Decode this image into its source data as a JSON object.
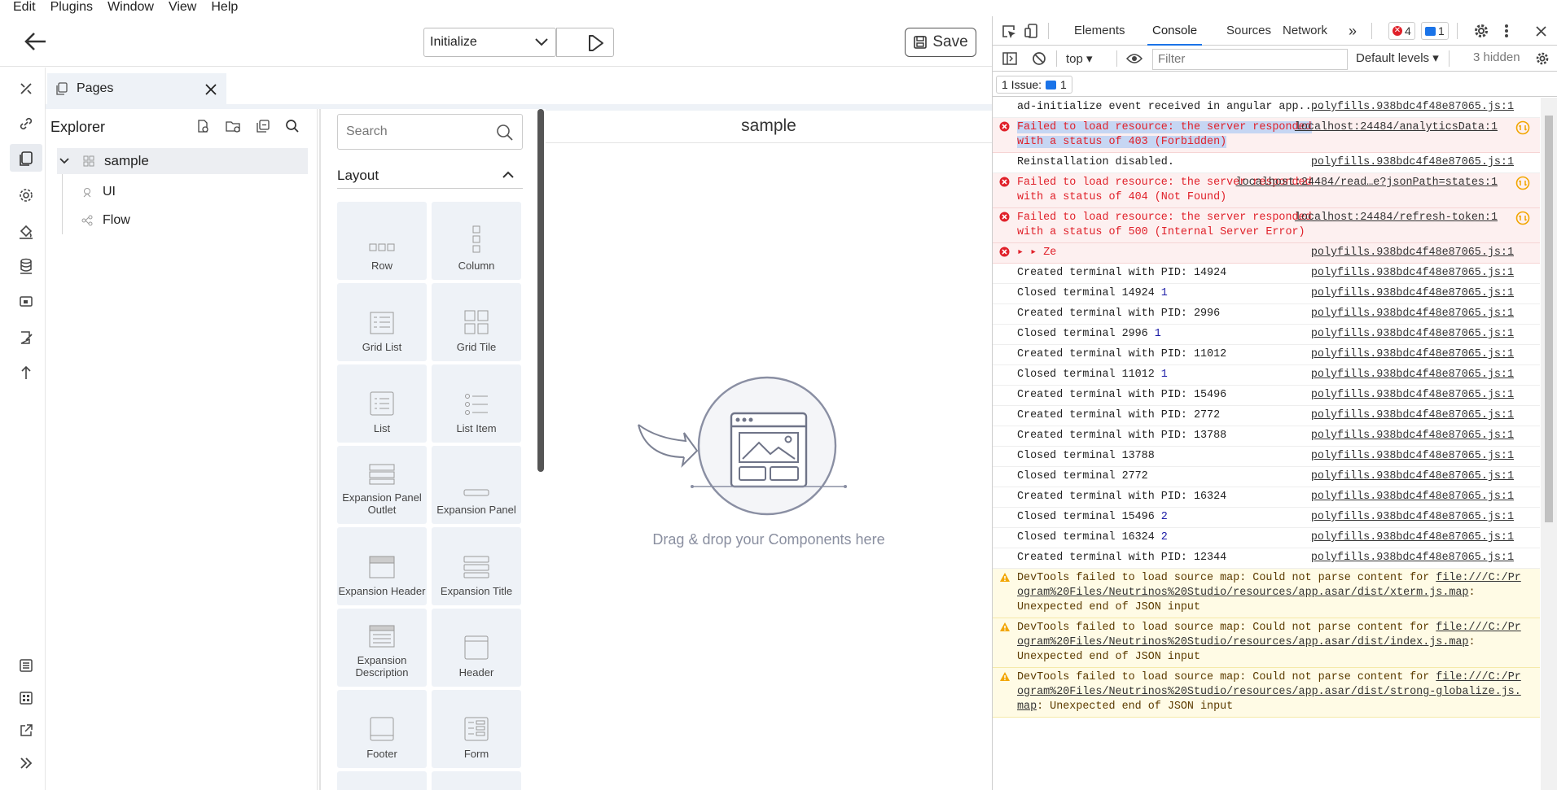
{
  "menu": [
    "Edit",
    "Plugins",
    "Window",
    "View",
    "Help"
  ],
  "toolbar": {
    "select_value": "Initialize",
    "save_label": "Save"
  },
  "pages_tab": {
    "label": "Pages"
  },
  "explorer": {
    "title": "Explorer",
    "tree": [
      {
        "label": "sample"
      },
      {
        "label": "UI"
      },
      {
        "label": "Flow"
      }
    ]
  },
  "palette": {
    "search_placeholder": "Search",
    "section": "Layout",
    "tiles": [
      {
        "label": "Row"
      },
      {
        "label": "Column"
      },
      {
        "label": "Grid List"
      },
      {
        "label": "Grid Tile"
      },
      {
        "label": "List"
      },
      {
        "label": "List Item"
      },
      {
        "label": "Expansion Panel Outlet"
      },
      {
        "label": "Expansion Panel"
      },
      {
        "label": "Expansion Header"
      },
      {
        "label": "Expansion Title"
      },
      {
        "label": "Expansion Description"
      },
      {
        "label": "Header"
      },
      {
        "label": "Footer"
      },
      {
        "label": "Form"
      }
    ]
  },
  "canvas": {
    "title": "sample",
    "drop_text": "Drag & drop your Components here"
  },
  "devtools": {
    "tabs": [
      "Elements",
      "Console",
      "Sources",
      "Network"
    ],
    "error_count": "4",
    "message_count": "1",
    "context": "top",
    "filter_placeholder": "Filter",
    "levels": "Default levels",
    "hidden": "3 hidden",
    "issues_label": "1 Issue:",
    "issues_count": "1",
    "logs": [
      {
        "type": "log",
        "msg": "ad-initialize event received in angular app....",
        "src": "polyfills.938bdc4f48e87065.js:1"
      },
      {
        "type": "err",
        "msg": "Failed to load resource: the server responded with a status of 403 (Forbidden)",
        "src": "localhost:24484/analyticsData:1"
      },
      {
        "type": "log",
        "msg": "Reinstallation disabled.",
        "src": "polyfills.938bdc4f48e87065.js:1"
      },
      {
        "type": "err",
        "msg": "Failed to load resource: the server responded with a status of 404 (Not Found)",
        "src": "localhost:24484/read…e?jsonPath=states:1"
      },
      {
        "type": "err",
        "msg": "Failed to load resource: the server responded with a status of 500 (Internal Server Error)",
        "src": "localhost:24484/refresh-token:1"
      },
      {
        "type": "err",
        "msg": "▸ ▸ Ze",
        "src": "polyfills.938bdc4f48e87065.js:1"
      },
      {
        "type": "log",
        "msg": "Created terminal with PID: 14924",
        "src": "polyfills.938bdc4f48e87065.js:1"
      },
      {
        "type": "log",
        "msg": "Closed terminal 14924",
        "num": "1",
        "src": "polyfills.938bdc4f48e87065.js:1"
      },
      {
        "type": "log",
        "msg": "Created terminal with PID: 2996",
        "src": "polyfills.938bdc4f48e87065.js:1"
      },
      {
        "type": "log",
        "msg": "Closed terminal 2996",
        "num": "1",
        "src": "polyfills.938bdc4f48e87065.js:1"
      },
      {
        "type": "log",
        "msg": "Created terminal with PID: 11012",
        "src": "polyfills.938bdc4f48e87065.js:1"
      },
      {
        "type": "log",
        "msg": "Closed terminal 11012",
        "num": "1",
        "src": "polyfills.938bdc4f48e87065.js:1"
      },
      {
        "type": "log",
        "msg": "Created terminal with PID: 15496",
        "src": "polyfills.938bdc4f48e87065.js:1"
      },
      {
        "type": "log",
        "msg": "Created terminal with PID: 2772",
        "src": "polyfills.938bdc4f48e87065.js:1"
      },
      {
        "type": "log",
        "msg": "Created terminal with PID: 13788",
        "src": "polyfills.938bdc4f48e87065.js:1"
      },
      {
        "type": "log",
        "msg": "Closed terminal 13788",
        "src": "polyfills.938bdc4f48e87065.js:1"
      },
      {
        "type": "log",
        "msg": "Closed terminal 2772",
        "src": "polyfills.938bdc4f48e87065.js:1"
      },
      {
        "type": "log",
        "msg": "Created terminal with PID: 16324",
        "src": "polyfills.938bdc4f48e87065.js:1"
      },
      {
        "type": "log",
        "msg": "Closed terminal 15496",
        "num": "2",
        "src": "polyfills.938bdc4f48e87065.js:1"
      },
      {
        "type": "log",
        "msg": "Closed terminal 16324",
        "num": "2",
        "src": "polyfills.938bdc4f48e87065.js:1"
      },
      {
        "type": "log",
        "msg": "Created terminal with PID: 12344",
        "src": "polyfills.938bdc4f48e87065.js:1"
      },
      {
        "type": "warn",
        "msg": "DevTools failed to load source map: Could not parse content for ",
        "link": "file:///C:/Program%20Files/Neutrinos%20Studio/resources/app.asar/dist/xterm.js.map",
        "tail": ": Unexpected end of JSON input"
      },
      {
        "type": "warn",
        "msg": "DevTools failed to load source map: Could not parse content for ",
        "link": "file:///C:/Program%20Files/Neutrinos%20Studio/resources/app.asar/dist/index.js.map",
        "tail": ": Unexpected end of JSON input"
      },
      {
        "type": "warn",
        "msg": "DevTools failed to load source map: Could not parse content for ",
        "link": "file:///C:/Program%20Files/Neutrinos%20Studio/resources/app.asar/dist/strong-globalize.js.map",
        "tail": ": Unexpected end of JSON input"
      }
    ]
  },
  "colors": {
    "accent": "#1a73e8",
    "error": "#e0212a",
    "panel_bg": "#eef2f7"
  }
}
